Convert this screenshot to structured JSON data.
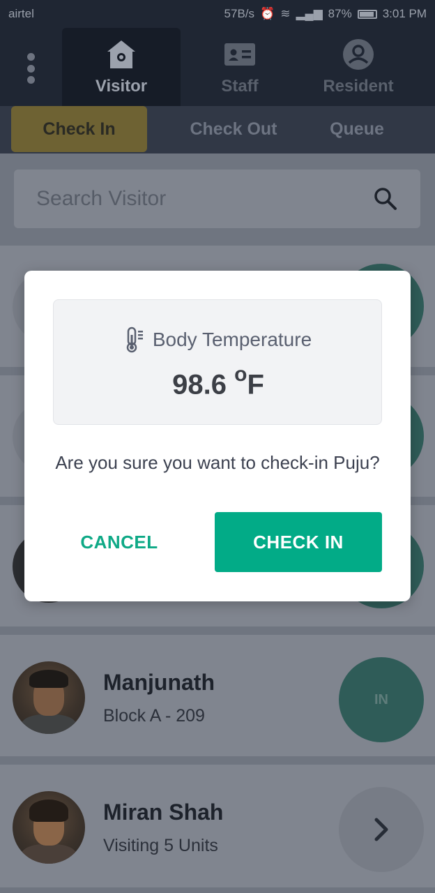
{
  "status_bar": {
    "carrier": "airtel",
    "speed": "57B/s",
    "battery": "87%",
    "time": "3:01 PM"
  },
  "header": {
    "tabs": [
      {
        "label": "Visitor",
        "icon": "house-icon",
        "active": true
      },
      {
        "label": "Staff",
        "icon": "id-card-icon",
        "active": false
      },
      {
        "label": "Resident",
        "icon": "user-circle-icon",
        "active": false
      }
    ]
  },
  "subtabs": [
    {
      "label": "Check In",
      "active": true
    },
    {
      "label": "Check Out",
      "active": false
    },
    {
      "label": "Queue",
      "active": false
    }
  ],
  "search": {
    "placeholder": "Search Visitor"
  },
  "visitors": [
    {
      "name": "Manjunath",
      "sub": "Block A - 209",
      "action": "IN"
    },
    {
      "name": "Miran Shah",
      "sub": "Visiting 5 Units",
      "action": "chevron-right-icon"
    }
  ],
  "dialog": {
    "temp_label": "Body Temperature",
    "temp_value": "98.6",
    "temp_unit_degree": "o",
    "temp_unit": "F",
    "question": "Are you sure you want to check-in Puju?",
    "cancel_label": "CANCEL",
    "confirm_label": "CHECK IN"
  },
  "colors": {
    "header_bg": "#1f2633",
    "accent_green": "#02ab87",
    "active_subtab": "#6e6233"
  }
}
